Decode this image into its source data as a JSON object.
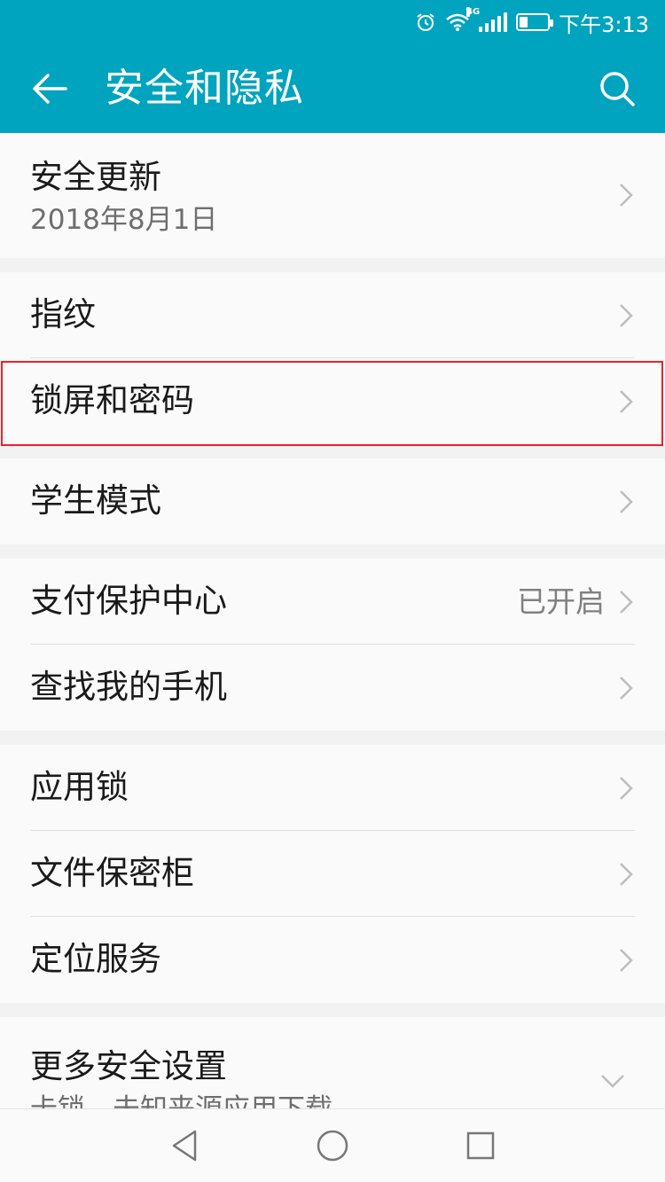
{
  "status_bar": {
    "time": "下午3:13",
    "network": "4G",
    "battery_level": 0.3,
    "icons": [
      "alarm-icon",
      "wifi-icon",
      "signal-icon",
      "battery-icon"
    ]
  },
  "app_bar": {
    "title": "安全和隐私",
    "back_icon": "arrow-left-icon",
    "search_icon": "search-icon"
  },
  "colors": {
    "accent": "#00a4bf",
    "highlight_border": "#e8232b",
    "background": "#f2f2f2",
    "row_background": "#fafafa"
  },
  "groups": [
    {
      "items": [
        {
          "label": "安全更新",
          "subtitle": "2018年8月1日"
        }
      ]
    },
    {
      "items": [
        {
          "label": "指纹"
        },
        {
          "label": "锁屏和密码",
          "highlighted": true
        }
      ]
    },
    {
      "items": [
        {
          "label": "学生模式"
        }
      ]
    },
    {
      "items": [
        {
          "label": "支付保护中心",
          "value": "已开启"
        },
        {
          "label": "查找我的手机"
        }
      ]
    },
    {
      "items": [
        {
          "label": "应用锁"
        },
        {
          "label": "文件保密柜"
        },
        {
          "label": "定位服务"
        }
      ]
    },
    {
      "items": [
        {
          "label": "更多安全设置",
          "subtitle": "卡锁、未知来源应用下载"
        }
      ]
    }
  ],
  "nav_bar": {
    "back": "triangle-back-icon",
    "home": "circle-home-icon",
    "recents": "square-recents-icon"
  }
}
